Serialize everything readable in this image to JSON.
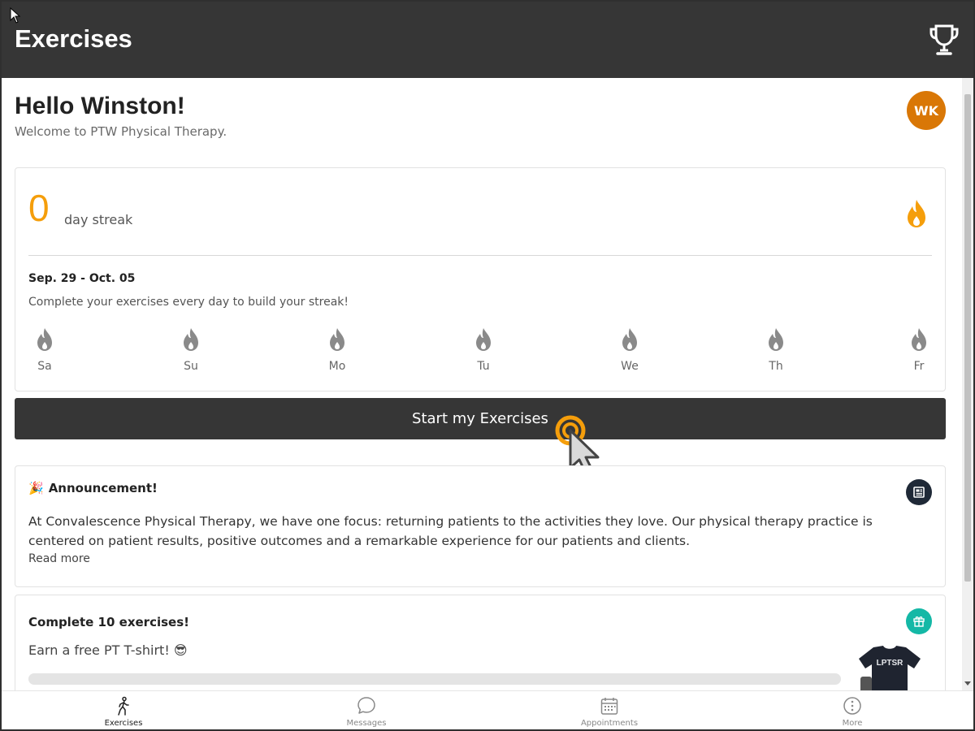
{
  "header": {
    "title": "Exercises",
    "trophy_icon": "trophy-icon"
  },
  "greeting": {
    "hello": "Hello Winston!",
    "welcome": "Welcome to PTW Physical Therapy.",
    "avatar_initials": "WK"
  },
  "streak": {
    "count": "0",
    "label": "day streak",
    "week_range": "Sep. 29 - Oct. 05",
    "instruction": "Complete your exercises every day to build your streak!",
    "days": [
      "Sa",
      "Su",
      "Mo",
      "Tu",
      "We",
      "Th",
      "Fr"
    ],
    "flame_icon": "flame-icon"
  },
  "start_button": {
    "label": "Start my Exercises"
  },
  "announcement": {
    "emoji": "🎉",
    "title": "Announcement!",
    "body": "At Convalescence Physical Therapy, we have one focus: returning patients to the activities they love. Our physical therapy practice is centered on patient results, positive outcomes and a remarkable experience for our patients and clients.",
    "read_more": "Read more",
    "icon": "newspaper-icon"
  },
  "goal": {
    "title": "Complete 10 exercises!",
    "subtitle": "Earn a free PT T-shirt! 😎",
    "progress": 0,
    "icon": "gift-icon",
    "shirt_text": "LPTSR"
  },
  "bottom_nav": {
    "items": [
      {
        "label": "Exercises",
        "icon": "walking-person-icon"
      },
      {
        "label": "Messages",
        "icon": "chat-bubble-icon"
      },
      {
        "label": "Appointments",
        "icon": "calendar-icon"
      },
      {
        "label": "More",
        "icon": "more-icon"
      }
    ]
  },
  "colors": {
    "header_bg": "#363636",
    "accent_orange": "#f59e0b",
    "avatar_bg": "#d97706",
    "gift_teal": "#14b8a6"
  }
}
